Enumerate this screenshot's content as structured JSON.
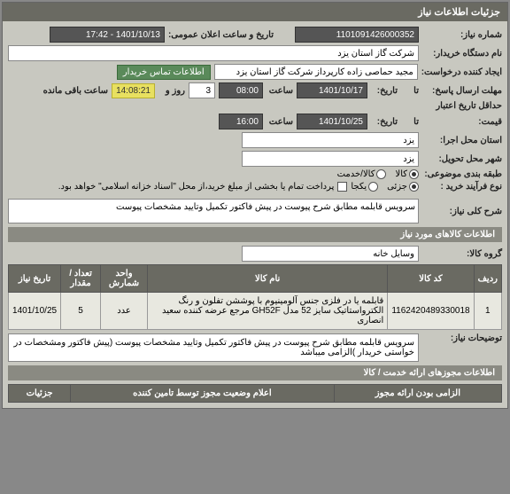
{
  "header": {
    "title": "جزئیات اطلاعات نیاز"
  },
  "info": {
    "need_no_label": "شماره نیاز:",
    "need_no": "1101091426000352",
    "datetime_label": "تاریخ و ساعت اعلان عمومی:",
    "datetime": "1401/10/13 - 17:42",
    "buyer_label": "نام دستگاه خریدار:",
    "buyer": "شرکت گاز استان یزد",
    "requester_label": "ایجاد کننده درخواست:",
    "requester": "مجید حماصی زاده کارپرداز شرکت گاز استان یزد",
    "contact_link": "اطلاعات تماس خریدار",
    "send_deadline_label": "مهلت ارسال پاسخ:",
    "to_label": "تا",
    "date_label": "تاریخ:",
    "send_date": "1401/10/17",
    "time_label": "ساعت",
    "send_time": "08:00",
    "days": "3",
    "days_label": "روز و",
    "remain_time": "14:08:21",
    "remain_label": "ساعت باقی مانده",
    "validity_label": "حداقل تاریخ اعتبار",
    "price_label": "قیمت:",
    "validity_date": "1401/10/25",
    "validity_time": "16:00",
    "exec_province_label": "استان محل اجرا:",
    "exec_province": "یزد",
    "deliver_city_label": "شهر محل تحویل:",
    "deliver_city": "یزد",
    "category_label": "طبقه بندی موضوعی:",
    "cat_goods": "کالا",
    "cat_service": "کالا/خدمت",
    "purchase_type_label": "نوع فرآیند خرید :",
    "pt_partial": "جزئی",
    "pt_full": "یکجا",
    "payment_note": "پرداخت تمام یا بخشی از مبلغ خرید،از محل \"اسناد خزانه اسلامی\" خواهد بود.",
    "desc_label": "شرح کلی نیاز:",
    "desc": "سرویس قابلمه مطابق شرح پیوست در پیش فاکتور تکمیل وتایید مشخصات پیوست"
  },
  "goods": {
    "section_title": "اطلاعات کالاهای مورد نیاز",
    "group_label": "گروه کالا:",
    "group_value": "وسایل خانه",
    "columns": {
      "row": "ردیف",
      "code": "کد کالا",
      "name": "نام کالا",
      "unit": "واحد شمارش",
      "qty": "تعداد / مقدار",
      "date": "تاریخ نیاز"
    },
    "rows": [
      {
        "row": "1",
        "code": "1162420489330018",
        "name": "قابلمه یا در فلزی جنس آلومینیوم با پوششن تفلون و رنگ الکترواستاتیک سایز 52 مدل GH52F مرجع عرضه کننده سعید انصاری",
        "unit": "عدد",
        "qty": "5",
        "date": "1401/10/25"
      }
    ],
    "note_label": "توضیحات نیاز:",
    "note": "سرویس قابلمه مطابق شرح پیوست در پیش فاکتور تکمیل وتایید مشخصات پیوست (پیش فاکتور ومشخصات در خواستی خریدار )الزامی میباشد"
  },
  "footer": {
    "permits_title": "اطلاعات مجوزهای ارائه خدمت / کالا",
    "mandatory_title": "الزامی بودن ارائه مجوز",
    "guarantee_title": "اعلام وضعیت مجوز توسط تامین کننده",
    "details_title": "جزئیات"
  }
}
